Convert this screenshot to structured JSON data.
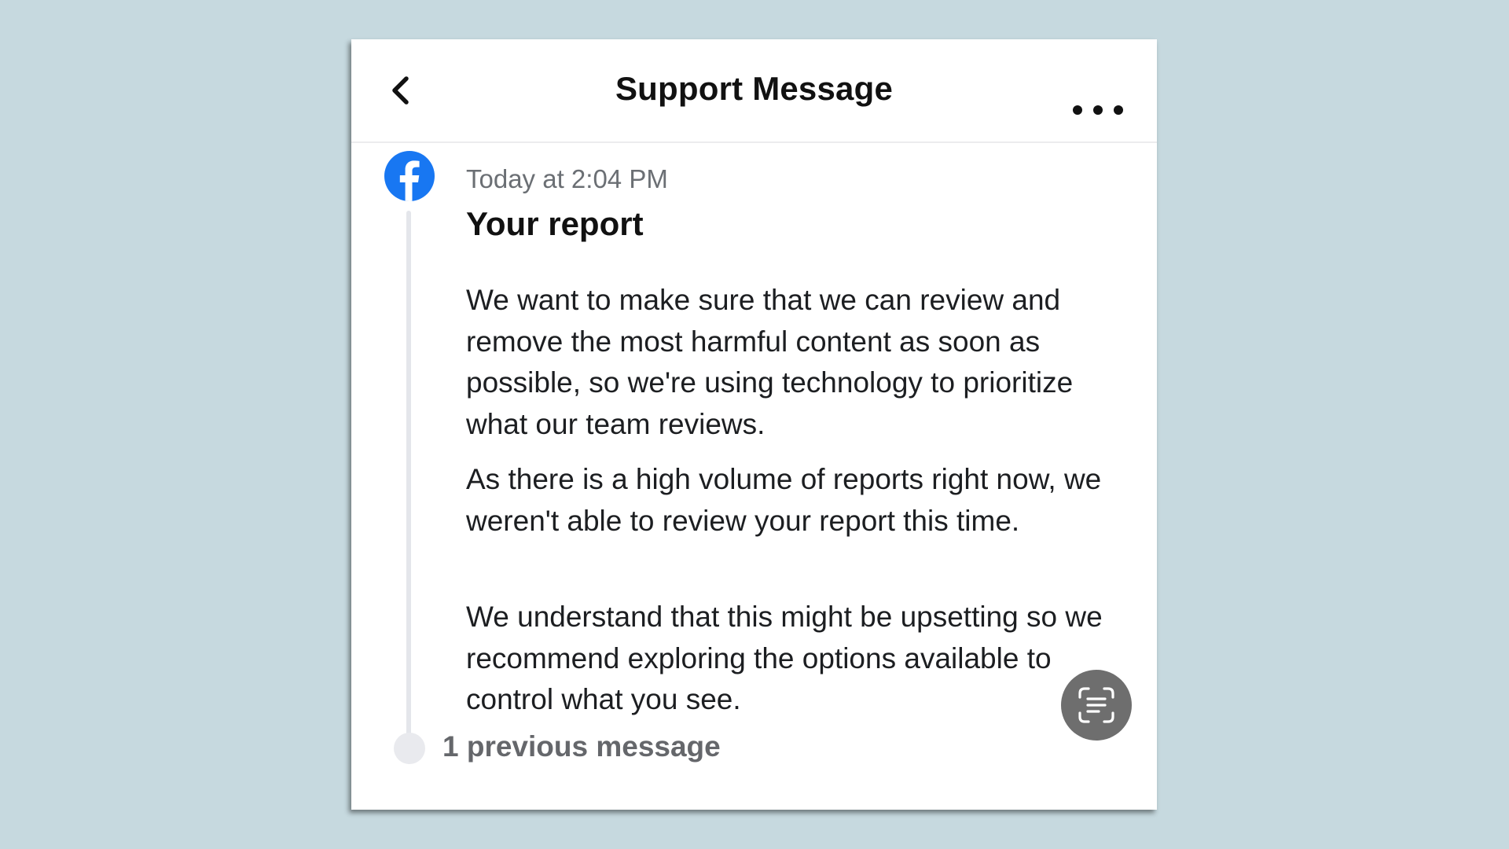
{
  "header": {
    "title": "Support Message"
  },
  "message": {
    "timestamp": "Today at 2:04 PM",
    "title": "Your report",
    "paragraphs": [
      "We want to make sure that we can review and remove the most harmful content as soon as possible, so we're using technology to prioritize what our team reviews.",
      "As there is a high volume of reports right now, we weren't able to review your report this time.",
      "We understand that this might be upsetting so we recommend exploring the options available to control what you see."
    ]
  },
  "thread": {
    "previous_label": "1 previous message"
  },
  "colors": {
    "background": "#c6d9df",
    "facebook_blue": "#1877f2",
    "scan_button": "#6e6e6e"
  },
  "icons": {
    "back": "chevron-left-icon",
    "more": "more-horizontal-icon",
    "sender": "facebook-logo-icon",
    "scan": "live-text-icon"
  }
}
